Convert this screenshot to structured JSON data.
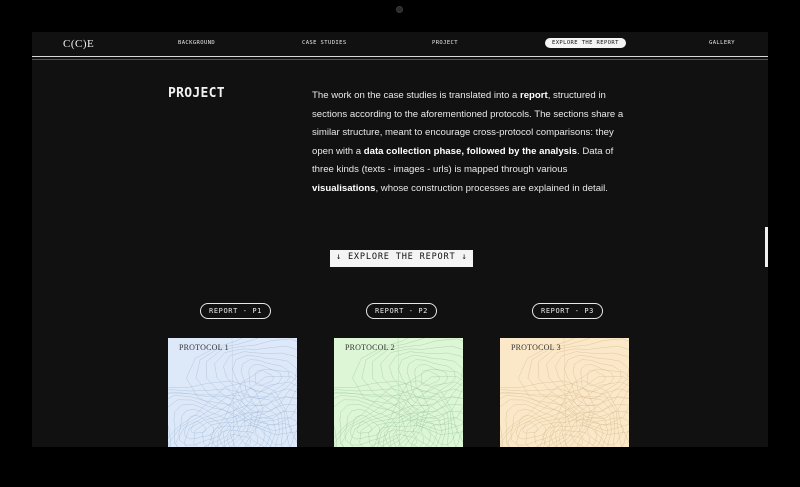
{
  "nav": {
    "logo": "C(C)E",
    "items": [
      {
        "label": "BACKGROUND"
      },
      {
        "label": "CASE STUDIES"
      },
      {
        "label": "PROJECT"
      },
      {
        "label": "EXPLORE THE REPORT",
        "active": true
      },
      {
        "label": "GALLERY"
      }
    ]
  },
  "project": {
    "title": "PROJECT",
    "intro": {
      "p1": "The work on the case studies is translated into a ",
      "b1": "report",
      "p2": ", structured in sections according to the aforementioned protocols. The sections share a similar structure, meant to encourage cross-protocol comparisons: they open with a ",
      "b2": "data collection phase, followed by the analysis",
      "p3": ". Data of three kinds (texts - images - urls) is mapped through various ",
      "b3": "visualisations",
      "p4": ", whose construction processes are explained in detail."
    }
  },
  "explore_button": "↓ EXPLORE THE REPORT ↓",
  "reports": [
    {
      "pill": "REPORT - P1",
      "card_label": "PROTOCOL 1",
      "color": "#dde9f9",
      "line_color": "#9fb6d6"
    },
    {
      "pill": "REPORT - P2",
      "card_label": "PROTOCOL 2",
      "color": "#dcf6d6",
      "line_color": "#9cc699"
    },
    {
      "pill": "REPORT - P3",
      "card_label": "PROTOCOL 3",
      "color": "#fbe8c8",
      "line_color": "#d4b98e"
    }
  ],
  "colors": {
    "background": "#111111",
    "text": "#e9e9e9",
    "accent": "#f4f4f4"
  }
}
